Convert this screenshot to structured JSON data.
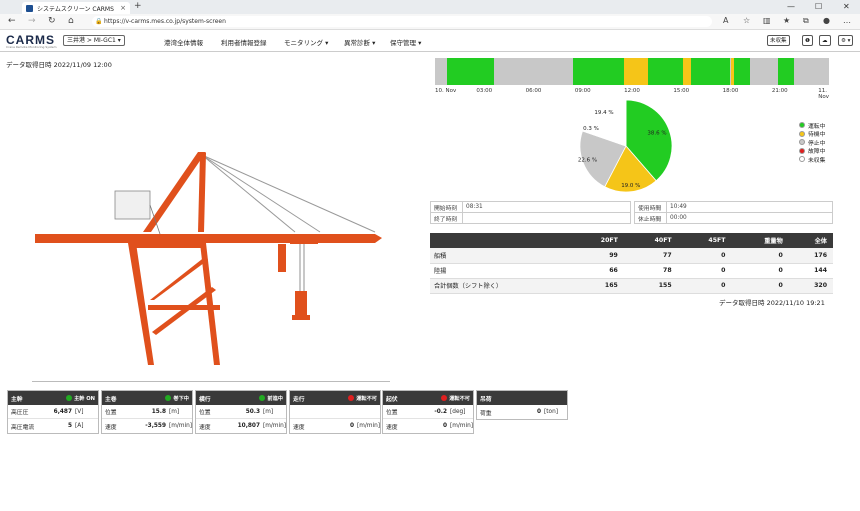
{
  "browser": {
    "tab_title": "システムスクリーン CARMS",
    "tab_close": "×",
    "new_tab": "+",
    "url": "https://v-carms.mes.co.jp/system-screen",
    "win_min": "—",
    "win_max": "☐",
    "win_close": "✕"
  },
  "app": {
    "logo": "CARMS",
    "logo_sub": "Crane Remote Monitoring System",
    "site_selector": "三井港 > MI-GC1 ▾",
    "menu": [
      "港湾全体情報",
      "利用者情報登録",
      "モニタリング ▾",
      "異常診断 ▾",
      "保守管理 ▾"
    ],
    "right_btns": [
      "未収集",
      "❶",
      "☁",
      "⚙ ▾"
    ]
  },
  "top_timestamp": "データ取得日時 2022/11/09 12:00",
  "timeline": {
    "labels": [
      "10. Nov",
      "03:00",
      "06:00",
      "09:00",
      "12:00",
      "15:00",
      "18:00",
      "21:00",
      "11. Nov"
    ],
    "colors": {
      "operating": "#22cc22",
      "waiting": "#f5c518",
      "stopped": "#c8c8c8"
    },
    "segments": [
      {
        "start": 0.03,
        "end": 0.15,
        "state": "operating"
      },
      {
        "start": 0.35,
        "end": 0.48,
        "state": "operating"
      },
      {
        "start": 0.48,
        "end": 0.54,
        "state": "waiting"
      },
      {
        "start": 0.54,
        "end": 0.63,
        "state": "operating"
      },
      {
        "start": 0.63,
        "end": 0.65,
        "state": "waiting"
      },
      {
        "start": 0.65,
        "end": 0.75,
        "state": "operating"
      },
      {
        "start": 0.75,
        "end": 0.76,
        "state": "waiting"
      },
      {
        "start": 0.76,
        "end": 0.8,
        "state": "operating"
      },
      {
        "start": 0.87,
        "end": 0.91,
        "state": "operating"
      }
    ]
  },
  "pie": {
    "slices": [
      {
        "label": "38.6 %",
        "value": 38.6,
        "color": "#22cc22"
      },
      {
        "label": "19.0 %",
        "value": 19.0,
        "color": "#f5c518"
      },
      {
        "label": "22.6 %",
        "value": 22.6,
        "color": "#c8c8c8"
      },
      {
        "label": "0.3 %",
        "value": 0.3,
        "color": "#e02020"
      },
      {
        "label": "19.4 %",
        "value": 19.4,
        "color": "#ffffff"
      }
    ]
  },
  "legend": [
    {
      "label": "運転中",
      "color": "#22cc22"
    },
    {
      "label": "待機中",
      "color": "#f5c518"
    },
    {
      "label": "停止中",
      "color": "#c8c8c8"
    },
    {
      "label": "故障中",
      "color": "#e02020"
    },
    {
      "label": "未収集",
      "color": "#ffffff"
    }
  ],
  "times": {
    "start_label": "開始時刻",
    "start_value": "08:31",
    "end_label": "終了時刻",
    "end_value": "",
    "usage_label": "使用時間",
    "usage_value": "10:49",
    "rest_label": "休止時間",
    "rest_value": "00:00"
  },
  "summary": {
    "headers": [
      "",
      "20FT",
      "40FT",
      "45FT",
      "重量物",
      "全体"
    ],
    "rows": [
      [
        "船積",
        "99",
        "77",
        "0",
        "0",
        "176"
      ],
      [
        "陸揚",
        "66",
        "78",
        "0",
        "0",
        "144"
      ],
      [
        "合計個数（シフト除く）",
        "165",
        "155",
        "0",
        "0",
        "320"
      ]
    ]
  },
  "bottom_timestamp": "データ取得日時 2022/11/10 19:21",
  "cards": [
    {
      "title": "主幹",
      "status": "主幹 ON",
      "status_color": "#22aa22",
      "rows": [
        {
          "label": "高圧圧",
          "value": "6,487",
          "unit": "[V]"
        },
        {
          "label": "高圧電流",
          "value": "5",
          "unit": "[A]"
        }
      ]
    },
    {
      "title": "主巻",
      "status": "巻下中",
      "status_color": "#22aa22",
      "rows": [
        {
          "label": "位置",
          "value": "15.8",
          "unit": "[m]"
        },
        {
          "label": "速度",
          "value": "-3,559",
          "unit": "[m/min]"
        }
      ]
    },
    {
      "title": "横行",
      "status": "前進中",
      "status_color": "#22aa22",
      "rows": [
        {
          "label": "位置",
          "value": "50.3",
          "unit": "[m]"
        },
        {
          "label": "速度",
          "value": "10,807",
          "unit": "[m/min]"
        }
      ]
    },
    {
      "title": "走行",
      "status": "運転不可",
      "status_color": "#e02020",
      "rows": [
        {
          "label": "",
          "value": "",
          "unit": ""
        },
        {
          "label": "速度",
          "value": "0",
          "unit": "[m/min]"
        }
      ]
    },
    {
      "title": "起伏",
      "status": "運転不可",
      "status_color": "#e02020",
      "rows": [
        {
          "label": "位置",
          "value": "-0.2",
          "unit": "[deg]"
        },
        {
          "label": "速度",
          "value": "0",
          "unit": "[m/min]"
        }
      ]
    },
    {
      "title": "吊荷",
      "status": "",
      "status_color": "",
      "rows": [
        {
          "label": "荷重",
          "value": "0",
          "unit": "[ton]"
        }
      ]
    }
  ]
}
